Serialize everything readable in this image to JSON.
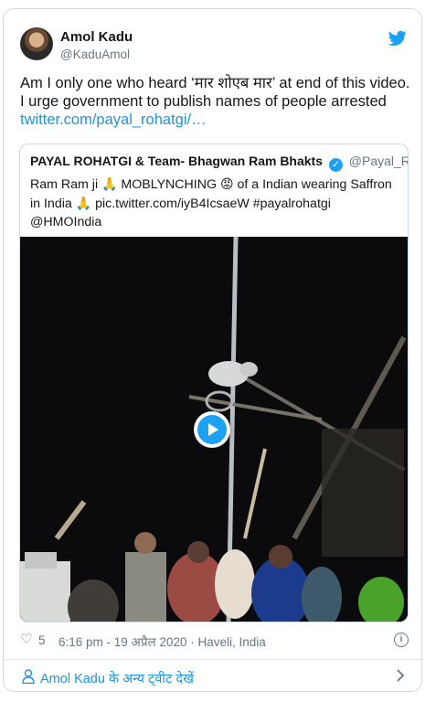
{
  "author": {
    "name": "Amol Kadu",
    "handle": "@KaduAmol"
  },
  "tweet": {
    "line1": "Am I only one who heard ‘मार शोएब मार’ at end of this video.",
    "line2": "I urge government to publish names of people arrested",
    "link": "twitter.com/payal_rohatgi/…"
  },
  "quoted": {
    "name": "PAYAL ROHATGI & Team- Bhagwan Ram Bhakts",
    "verified_badge": "✓",
    "handle": "@Payal_Rohatgi",
    "line1_a": "Ram Ram ji ",
    "emoji_pray": "🙏",
    "line1_b": " MOBLYNCHING ",
    "emoji_angry": "😡",
    "line1_c": " of a Indian wearing Saffron",
    "line2_a": "in India ",
    "line2_b": " pic.twitter.com/iyB4IcsaeW #payalrohatgi",
    "line3": "@HMOIndia"
  },
  "meta": {
    "heart_glyph": "♡",
    "likes": "5",
    "timestamp": "6:16 pm - 19 अप्रैल 2020 · Haveli, India",
    "info_glyph": "i"
  },
  "footer": {
    "more_tweets": "Amol Kadu के अन्य ट्वीट देखें"
  },
  "icons": {
    "brand": "twitter-bird-icon",
    "play": "play-icon",
    "info": "info-icon",
    "person": "person-icon",
    "chevron": "chevron-right-icon"
  },
  "colors": {
    "brand_blue": "#1da1f2",
    "link_blue": "#1b95e0",
    "secondary_text": "#657786",
    "border": "#cfd9de"
  }
}
